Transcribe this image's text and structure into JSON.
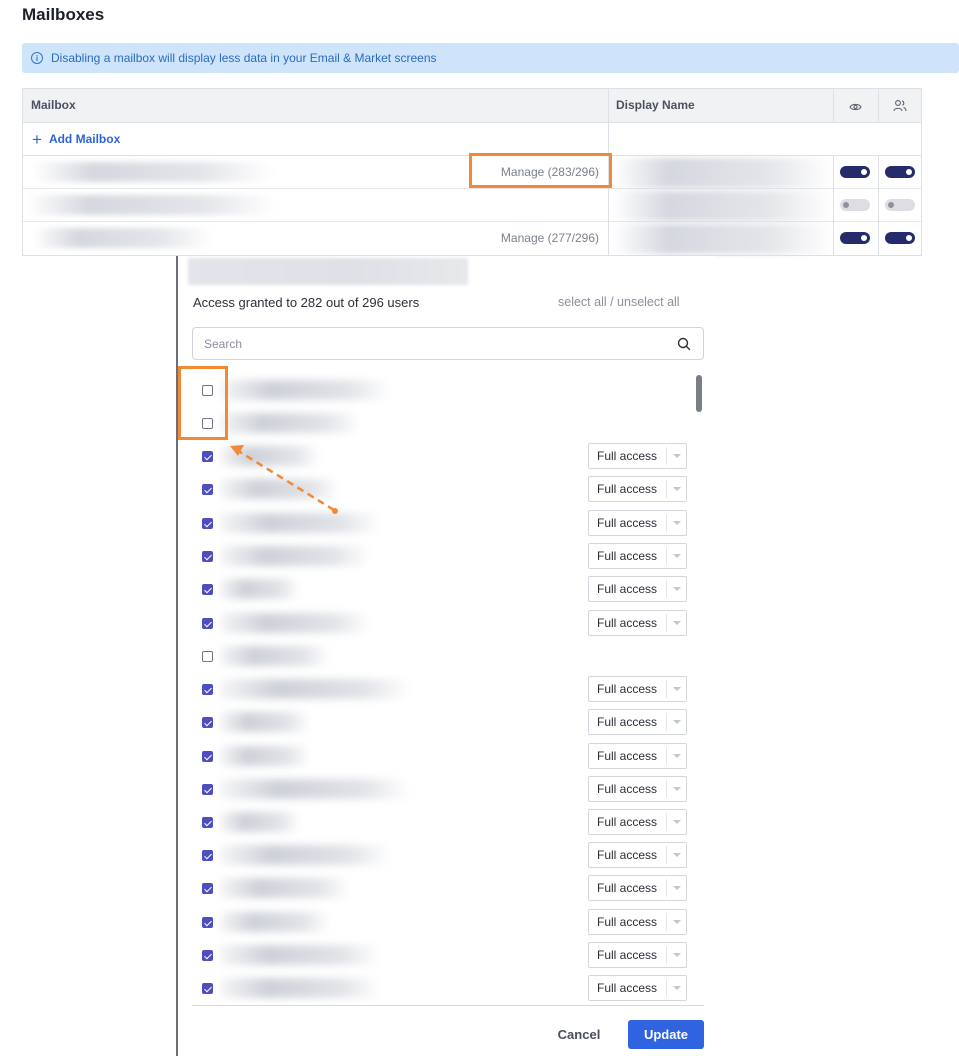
{
  "page": {
    "title": "Mailboxes"
  },
  "info_banner": {
    "icon": "info-icon",
    "text": "Disabling a mailbox will display less data in your Email & Market screens"
  },
  "mailbox_table": {
    "columns": {
      "mailbox": "Mailbox",
      "display_name": "Display Name",
      "visible_icon": "eye-icon",
      "users_icon": "users-icon"
    },
    "add_mailbox": "Add Mailbox",
    "rows": [
      {
        "manage": "Manage (283/296)",
        "visible_enabled": true,
        "shared_enabled": true
      },
      {
        "manage": "",
        "visible_enabled": false,
        "shared_enabled": false
      },
      {
        "manage": "Manage (277/296)",
        "visible_enabled": true,
        "shared_enabled": true
      }
    ]
  },
  "access_panel": {
    "summary": "Access granted to 282 out of 296 users",
    "select_all": "select all / unselect all",
    "search": {
      "placeholder": "Search",
      "icon": "search-icon"
    },
    "users": [
      {
        "checked": false,
        "access": ""
      },
      {
        "checked": false,
        "access": ""
      },
      {
        "checked": true,
        "access": "Full access"
      },
      {
        "checked": true,
        "access": "Full access"
      },
      {
        "checked": true,
        "access": "Full access"
      },
      {
        "checked": true,
        "access": "Full access"
      },
      {
        "checked": true,
        "access": "Full access"
      },
      {
        "checked": true,
        "access": "Full access"
      },
      {
        "checked": false,
        "access": ""
      },
      {
        "checked": true,
        "access": "Full access"
      },
      {
        "checked": true,
        "access": "Full access"
      },
      {
        "checked": true,
        "access": "Full access"
      },
      {
        "checked": true,
        "access": "Full access"
      },
      {
        "checked": true,
        "access": "Full access"
      },
      {
        "checked": true,
        "access": "Full access"
      },
      {
        "checked": true,
        "access": "Full access"
      },
      {
        "checked": true,
        "access": "Full access"
      },
      {
        "checked": true,
        "access": "Full access"
      },
      {
        "checked": true,
        "access": "Full access"
      }
    ],
    "cancel": "Cancel",
    "update": "Update"
  },
  "colors": {
    "accent": "#2f63e0",
    "toggle_on": "#262c6b",
    "highlight": "#f28a35",
    "checkbox": "#4e4fbd"
  }
}
